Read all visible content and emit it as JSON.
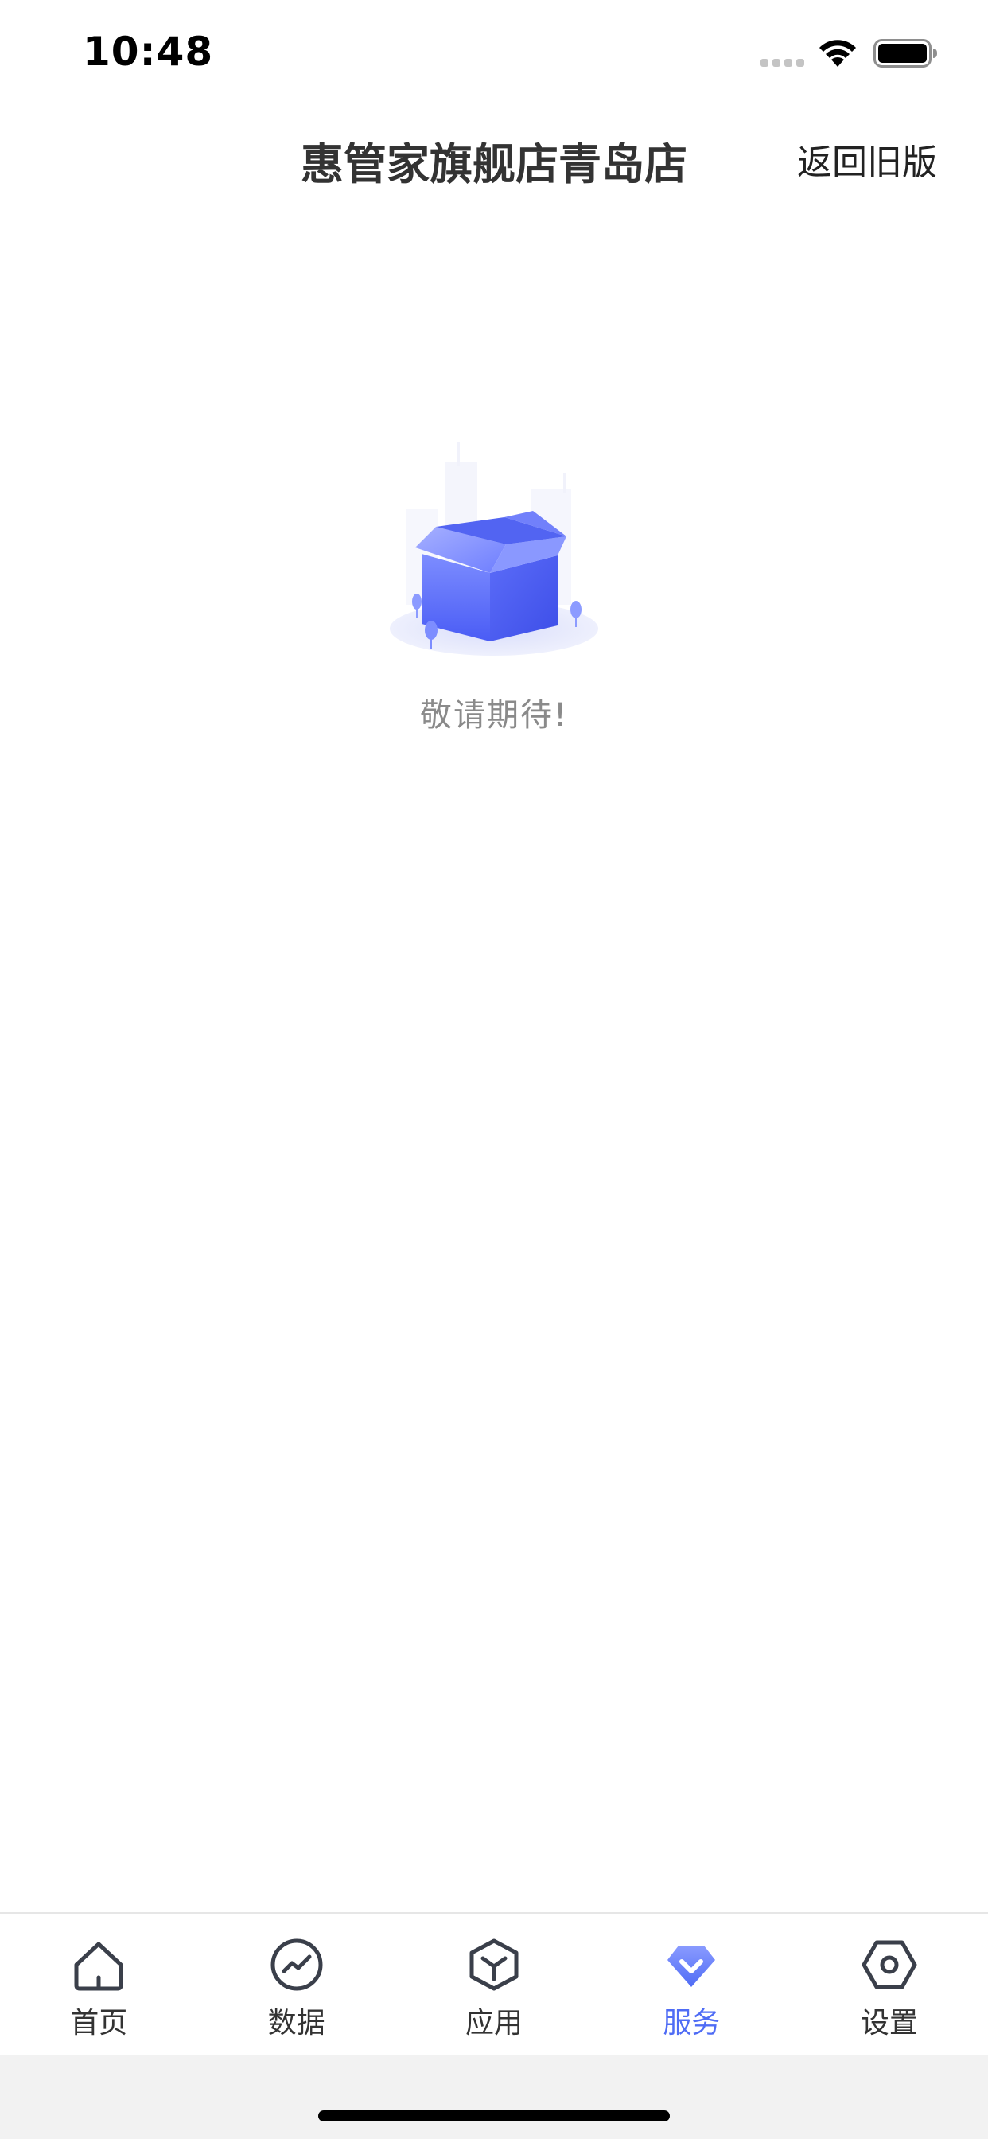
{
  "status_bar": {
    "time": "10:48"
  },
  "nav": {
    "title": "惠管家旗舰店青岛店",
    "back_to_old_label": "返回旧版"
  },
  "empty_state": {
    "illustration": "empty-box-illustration",
    "message": "敬请期待!"
  },
  "tab_bar": {
    "active_color": "#4f6cf5",
    "inactive_color": "#333333",
    "items": [
      {
        "label": "首页",
        "icon": "home-icon",
        "active": false
      },
      {
        "label": "数据",
        "icon": "chart-icon",
        "active": false
      },
      {
        "label": "应用",
        "icon": "cube-icon",
        "active": false
      },
      {
        "label": "服务",
        "icon": "service-icon",
        "active": true
      },
      {
        "label": "设置",
        "icon": "settings-icon",
        "active": false
      }
    ]
  }
}
